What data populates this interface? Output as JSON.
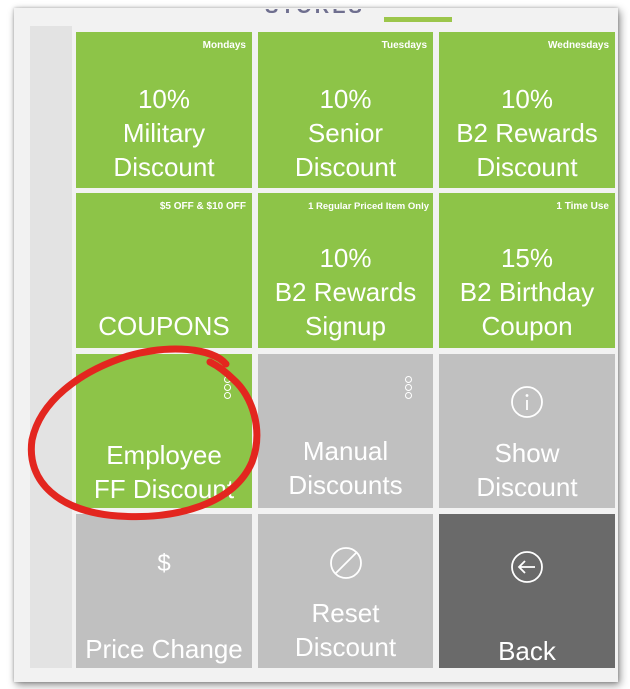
{
  "header": {
    "partial_title": "STORES"
  },
  "tiles": [
    {
      "tag": "Mondays",
      "lines": [
        "10%",
        "Military",
        "Discount"
      ]
    },
    {
      "tag": "Tuesdays",
      "lines": [
        "10%",
        "Senior",
        "Discount"
      ]
    },
    {
      "tag": "Wednesdays",
      "lines": [
        "10%",
        "B2 Rewards",
        "Discount"
      ]
    },
    {
      "tag": "$5 OFF & $10 OFF",
      "lines": [
        "COUPONS"
      ]
    },
    {
      "tag": "1 Regular Priced Item Only",
      "lines": [
        "10%",
        "B2 Rewards",
        "Signup"
      ]
    },
    {
      "tag": "1 Time Use",
      "lines": [
        "15%",
        "B2 Birthday",
        "Coupon"
      ]
    },
    {
      "lines": [
        "Employee",
        "FF Discount"
      ]
    },
    {
      "lines": [
        "Manual",
        "Discounts"
      ]
    },
    {
      "icon": "info-icon",
      "lines": [
        "Show",
        "Discount"
      ]
    },
    {
      "icon": "dollar-icon",
      "icon_text": "$",
      "lines": [
        "Price Change"
      ]
    },
    {
      "icon": "prohibited-icon",
      "lines": [
        "Reset",
        "Discount"
      ]
    },
    {
      "icon": "back-arrow-icon",
      "lines": [
        "Back"
      ]
    }
  ],
  "colors": {
    "green_tile": "#8dc448",
    "gray_tile": "#c0c0c0",
    "dark_tile": "#6a6a6a",
    "annotation_circle": "#e3261f"
  }
}
